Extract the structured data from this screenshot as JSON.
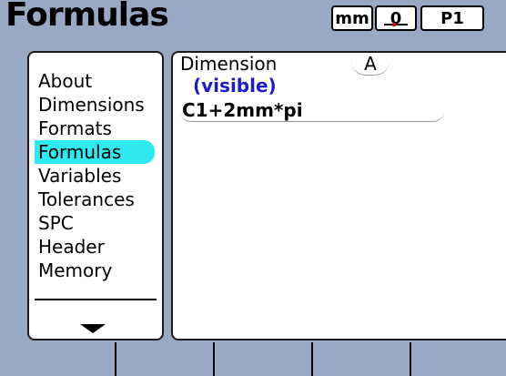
{
  "header": {
    "title": "Formulas",
    "unit": "mm",
    "zero_mode": "0",
    "preset": "P1"
  },
  "menu": {
    "items": [
      {
        "label": "About",
        "active": false
      },
      {
        "label": "Dimensions",
        "active": false
      },
      {
        "label": "Formats",
        "active": false
      },
      {
        "label": "Formulas",
        "active": true
      },
      {
        "label": "Variables",
        "active": false
      },
      {
        "label": "Tolerances",
        "active": false
      },
      {
        "label": "SPC",
        "active": false
      },
      {
        "label": "Header",
        "active": false
      },
      {
        "label": "Memory",
        "active": false
      }
    ],
    "more_icon": "down-arrow-icon"
  },
  "main": {
    "dimension_label": "Dimension",
    "dimension_value": "A",
    "visibility": "(visible)",
    "formula": "C1+2mm*pi"
  },
  "colors": {
    "background": "#9aa9c3",
    "highlight": "#2ee9ef",
    "visible_text": "#1b1bcc"
  }
}
